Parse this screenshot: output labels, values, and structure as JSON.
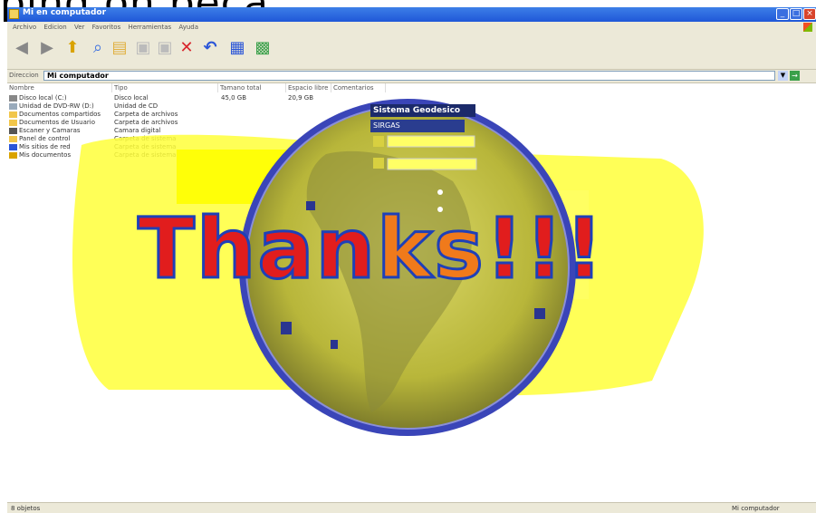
{
  "heading": "ping on peca",
  "window": {
    "title": "Mi en computador",
    "menu": [
      "Archivo",
      "Edicion",
      "Ver",
      "Favoritos",
      "Herramientas",
      "Ayuda"
    ]
  },
  "address": {
    "label": "Direccion",
    "value": "Mi computador"
  },
  "columns": [
    "Nombre",
    "Tipo",
    "Tamano total",
    "Espacio libre",
    "Comentarios"
  ],
  "rows": [
    {
      "name": "Disco local (C:)",
      "type": "Disco local",
      "size": "45,0 GB",
      "free": "20,9 GB"
    },
    {
      "name": "Unidad de DVD-RW (D:)",
      "type": "Unidad de CD",
      "size": "",
      "free": ""
    },
    {
      "name": "Documentos compartidos",
      "type": "Carpeta de archivos",
      "size": "",
      "free": ""
    },
    {
      "name": "Documentos de Usuario",
      "type": "Carpeta de archivos",
      "size": "",
      "free": ""
    },
    {
      "name": "Escaner y Camaras",
      "type": "Camara digital",
      "size": "",
      "free": ""
    },
    {
      "name": "Panel de control",
      "type": "Carpeta de sistema",
      "size": "",
      "free": ""
    },
    {
      "name": "Mis sitios de red",
      "type": "Carpeta de sistema",
      "size": "",
      "free": ""
    },
    {
      "name": "Mis documentos",
      "type": "Carpeta de sistema",
      "size": "",
      "free": ""
    }
  ],
  "status": {
    "left": "8 objetos",
    "right": "Mi computador"
  },
  "overlay": {
    "panel_title": "Sistema Geodesico",
    "panel_select": "SIRGAS",
    "thanks_main": "Than",
    "thanks_orange": "ks",
    "thanks_tail": "!!!"
  },
  "colors": {
    "titlebar": "#1f57d8",
    "highlight": "#ffff00",
    "globe_blue": "#3a45b8",
    "thanks_red": "#e11d1d",
    "thanks_orange": "#f07a1b",
    "thanks_outline": "#1e40b8"
  }
}
